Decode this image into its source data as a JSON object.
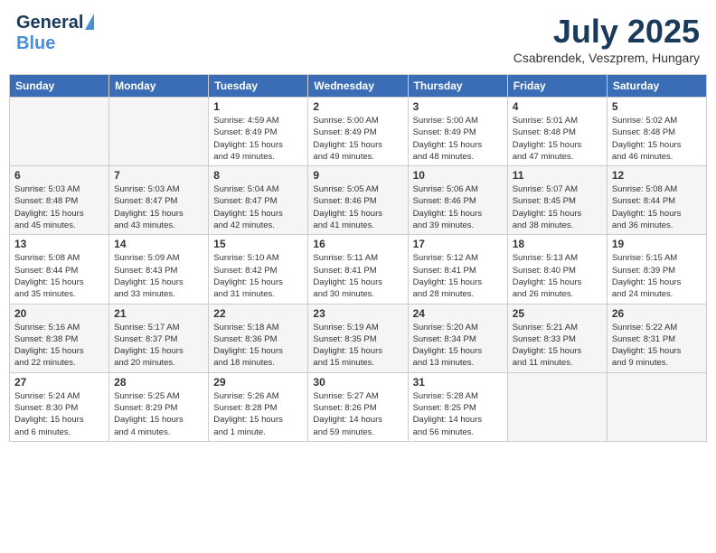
{
  "header": {
    "logo_general": "General",
    "logo_blue": "Blue",
    "month_title": "July 2025",
    "location": "Csabrendek, Veszprem, Hungary"
  },
  "days_of_week": [
    "Sunday",
    "Monday",
    "Tuesday",
    "Wednesday",
    "Thursday",
    "Friday",
    "Saturday"
  ],
  "weeks": [
    [
      {
        "day": "",
        "info": ""
      },
      {
        "day": "",
        "info": ""
      },
      {
        "day": "1",
        "info": "Sunrise: 4:59 AM\nSunset: 8:49 PM\nDaylight: 15 hours\nand 49 minutes."
      },
      {
        "day": "2",
        "info": "Sunrise: 5:00 AM\nSunset: 8:49 PM\nDaylight: 15 hours\nand 49 minutes."
      },
      {
        "day": "3",
        "info": "Sunrise: 5:00 AM\nSunset: 8:49 PM\nDaylight: 15 hours\nand 48 minutes."
      },
      {
        "day": "4",
        "info": "Sunrise: 5:01 AM\nSunset: 8:48 PM\nDaylight: 15 hours\nand 47 minutes."
      },
      {
        "day": "5",
        "info": "Sunrise: 5:02 AM\nSunset: 8:48 PM\nDaylight: 15 hours\nand 46 minutes."
      }
    ],
    [
      {
        "day": "6",
        "info": "Sunrise: 5:03 AM\nSunset: 8:48 PM\nDaylight: 15 hours\nand 45 minutes."
      },
      {
        "day": "7",
        "info": "Sunrise: 5:03 AM\nSunset: 8:47 PM\nDaylight: 15 hours\nand 43 minutes."
      },
      {
        "day": "8",
        "info": "Sunrise: 5:04 AM\nSunset: 8:47 PM\nDaylight: 15 hours\nand 42 minutes."
      },
      {
        "day": "9",
        "info": "Sunrise: 5:05 AM\nSunset: 8:46 PM\nDaylight: 15 hours\nand 41 minutes."
      },
      {
        "day": "10",
        "info": "Sunrise: 5:06 AM\nSunset: 8:46 PM\nDaylight: 15 hours\nand 39 minutes."
      },
      {
        "day": "11",
        "info": "Sunrise: 5:07 AM\nSunset: 8:45 PM\nDaylight: 15 hours\nand 38 minutes."
      },
      {
        "day": "12",
        "info": "Sunrise: 5:08 AM\nSunset: 8:44 PM\nDaylight: 15 hours\nand 36 minutes."
      }
    ],
    [
      {
        "day": "13",
        "info": "Sunrise: 5:08 AM\nSunset: 8:44 PM\nDaylight: 15 hours\nand 35 minutes."
      },
      {
        "day": "14",
        "info": "Sunrise: 5:09 AM\nSunset: 8:43 PM\nDaylight: 15 hours\nand 33 minutes."
      },
      {
        "day": "15",
        "info": "Sunrise: 5:10 AM\nSunset: 8:42 PM\nDaylight: 15 hours\nand 31 minutes."
      },
      {
        "day": "16",
        "info": "Sunrise: 5:11 AM\nSunset: 8:41 PM\nDaylight: 15 hours\nand 30 minutes."
      },
      {
        "day": "17",
        "info": "Sunrise: 5:12 AM\nSunset: 8:41 PM\nDaylight: 15 hours\nand 28 minutes."
      },
      {
        "day": "18",
        "info": "Sunrise: 5:13 AM\nSunset: 8:40 PM\nDaylight: 15 hours\nand 26 minutes."
      },
      {
        "day": "19",
        "info": "Sunrise: 5:15 AM\nSunset: 8:39 PM\nDaylight: 15 hours\nand 24 minutes."
      }
    ],
    [
      {
        "day": "20",
        "info": "Sunrise: 5:16 AM\nSunset: 8:38 PM\nDaylight: 15 hours\nand 22 minutes."
      },
      {
        "day": "21",
        "info": "Sunrise: 5:17 AM\nSunset: 8:37 PM\nDaylight: 15 hours\nand 20 minutes."
      },
      {
        "day": "22",
        "info": "Sunrise: 5:18 AM\nSunset: 8:36 PM\nDaylight: 15 hours\nand 18 minutes."
      },
      {
        "day": "23",
        "info": "Sunrise: 5:19 AM\nSunset: 8:35 PM\nDaylight: 15 hours\nand 15 minutes."
      },
      {
        "day": "24",
        "info": "Sunrise: 5:20 AM\nSunset: 8:34 PM\nDaylight: 15 hours\nand 13 minutes."
      },
      {
        "day": "25",
        "info": "Sunrise: 5:21 AM\nSunset: 8:33 PM\nDaylight: 15 hours\nand 11 minutes."
      },
      {
        "day": "26",
        "info": "Sunrise: 5:22 AM\nSunset: 8:31 PM\nDaylight: 15 hours\nand 9 minutes."
      }
    ],
    [
      {
        "day": "27",
        "info": "Sunrise: 5:24 AM\nSunset: 8:30 PM\nDaylight: 15 hours\nand 6 minutes."
      },
      {
        "day": "28",
        "info": "Sunrise: 5:25 AM\nSunset: 8:29 PM\nDaylight: 15 hours\nand 4 minutes."
      },
      {
        "day": "29",
        "info": "Sunrise: 5:26 AM\nSunset: 8:28 PM\nDaylight: 15 hours\nand 1 minute."
      },
      {
        "day": "30",
        "info": "Sunrise: 5:27 AM\nSunset: 8:26 PM\nDaylight: 14 hours\nand 59 minutes."
      },
      {
        "day": "31",
        "info": "Sunrise: 5:28 AM\nSunset: 8:25 PM\nDaylight: 14 hours\nand 56 minutes."
      },
      {
        "day": "",
        "info": ""
      },
      {
        "day": "",
        "info": ""
      }
    ]
  ]
}
